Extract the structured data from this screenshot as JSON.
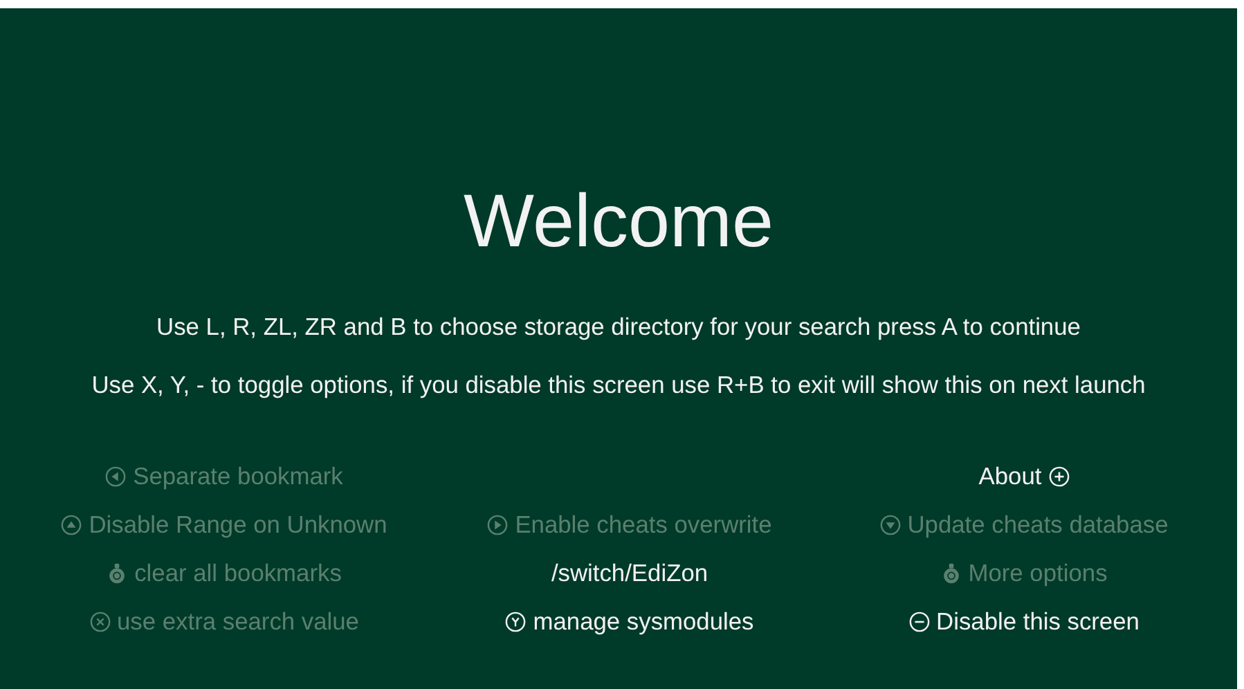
{
  "title": "Welcome",
  "instructions": [
    "Use L, R, ZL, ZR and B to choose storage directory for your search press A to continue",
    "Use X, Y, - to toggle options, if you disable this screen use R+B to exit will show this on next launch"
  ],
  "option_columns": [
    [
      {
        "label": "Separate bookmark",
        "kind": "left",
        "enabled": false
      },
      {
        "label": "Disable Range on Unknown",
        "kind": "up",
        "enabled": false
      },
      {
        "label": "clear all bookmarks",
        "kind": "stick",
        "enabled": false
      },
      {
        "label": "use extra search value",
        "kind": "x",
        "enabled": false
      }
    ],
    [
      {
        "label": "Enable cheats overwrite",
        "kind": "right",
        "enabled": false
      },
      {
        "label": "/switch/EdiZon",
        "enabled": true
      },
      {
        "label": "manage sysmodules",
        "kind": "y",
        "enabled": true
      }
    ],
    [
      {
        "label": "About",
        "kind": "plus",
        "icon_after": true,
        "enabled": true
      },
      {
        "label": "Update cheats database",
        "kind": "down",
        "enabled": false
      },
      {
        "label": "More options",
        "kind": "stick",
        "enabled": false
      },
      {
        "label": "Disable this screen",
        "kind": "minus",
        "enabled": true
      }
    ]
  ]
}
